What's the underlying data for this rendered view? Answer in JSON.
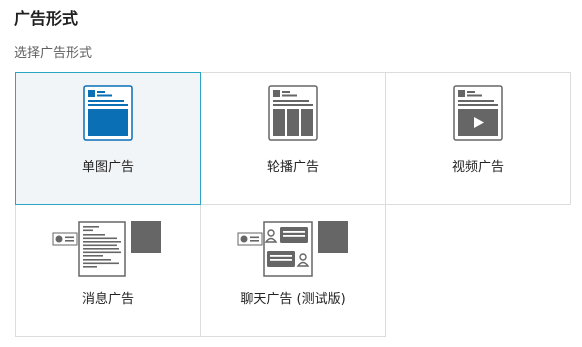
{
  "section": {
    "title": "广告形式",
    "subtitle": "选择广告形式"
  },
  "colors": {
    "selected_border": "#2aa6c4",
    "selected_background": "#f2f5f8",
    "accent_blue": "#0a6fb5",
    "icon_gray": "#666666"
  },
  "ad_formats": [
    {
      "label": "单图广告",
      "icon": "single-image-ad-icon",
      "selected": true
    },
    {
      "label": "轮播广告",
      "icon": "carousel-ad-icon",
      "selected": false
    },
    {
      "label": "视频广告",
      "icon": "video-ad-icon",
      "selected": false
    },
    {
      "label": "消息广告",
      "icon": "message-ad-icon",
      "selected": false
    },
    {
      "label": "聊天广告 (测试版)",
      "icon": "chat-ad-icon",
      "selected": false
    }
  ]
}
